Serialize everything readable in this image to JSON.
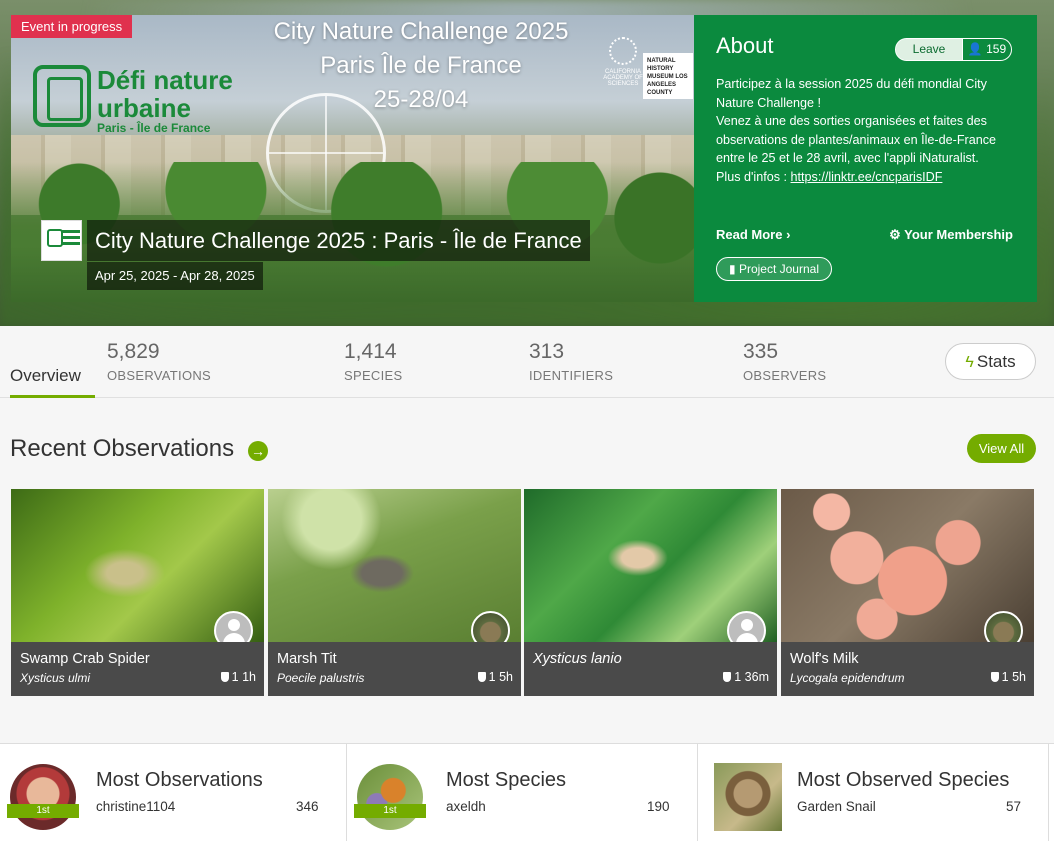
{
  "header": {
    "event_badge": "Event in progress",
    "banner_title_lines": [
      "City Nature Challenge 2025",
      "Paris Île de France",
      "25-28/04"
    ],
    "logo_lines": [
      "Défi nature",
      "urbaine",
      "Paris - Île de France"
    ],
    "sponsors": [
      "CALIFORNIA ACADEMY OF SCIENCES",
      "NATURAL HISTORY MUSEUM LOS ANGELES COUNTY"
    ],
    "project_title": "City Nature Challenge 2025 : Paris - Île de France",
    "project_dates": "Apr 25, 2025 - Apr 28, 2025"
  },
  "about": {
    "heading": "About",
    "leave_label": "Leave",
    "member_count": "159",
    "description_lines": [
      "Participez à la session 2025 du défi mondial City Nature Challenge !",
      "Venez à une des sorties organisées et faites des observations de plantes/animaux en Île-de-France entre le 25 et le 28 avril, avec l'appli iNaturalist.",
      "Plus d'infos : "
    ],
    "link_text": "https://linktr.ee/cncparisIDF",
    "read_more": "Read More",
    "membership": "Your Membership",
    "journal": "Project Journal"
  },
  "stats": {
    "overview_tab": "Overview",
    "items": [
      {
        "value": "5,829",
        "label": "OBSERVATIONS"
      },
      {
        "value": "1,414",
        "label": "SPECIES"
      },
      {
        "value": "313",
        "label": "IDENTIFIERS"
      },
      {
        "value": "335",
        "label": "OBSERVERS"
      }
    ],
    "stats_button": "Stats"
  },
  "recent": {
    "title": "Recent Observations",
    "view_all": "View All",
    "cards": [
      {
        "common": "Swamp Crab Spider",
        "scientific": "Xysticus ulmi",
        "meta": "1 1h"
      },
      {
        "common": "Marsh Tit",
        "scientific": "Poecile palustris",
        "meta": "1 5h"
      },
      {
        "common": "Xysticus lanio",
        "scientific": "",
        "meta": "1 36m"
      },
      {
        "common": "Wolf's Milk",
        "scientific": "Lycogala epidendrum",
        "meta": "1 5h"
      }
    ]
  },
  "leaderboards": [
    {
      "title": "Most Observations",
      "name": "christine1104",
      "count": "346",
      "rank": "1st"
    },
    {
      "title": "Most Species",
      "name": "axeldh",
      "count": "190",
      "rank": "1st"
    },
    {
      "title": "Most Observed Species",
      "name": "Garden Snail",
      "count": "57"
    }
  ],
  "colors": {
    "accent_green": "#74ac00",
    "about_green": "#0b8a3e",
    "badge_red": "#e0314e"
  }
}
